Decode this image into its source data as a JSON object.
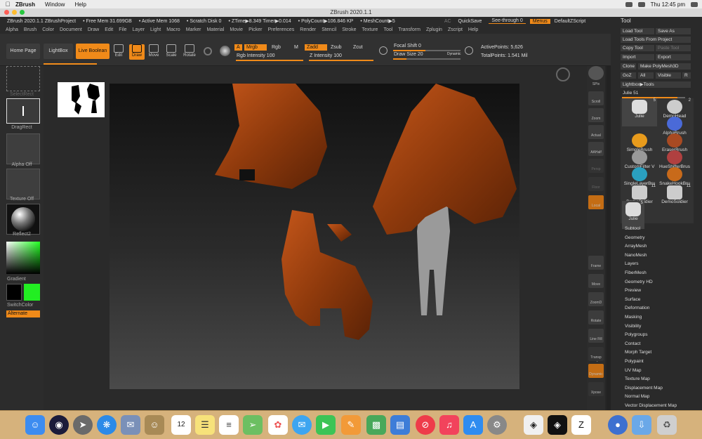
{
  "mac_menu": {
    "app": "ZBrush",
    "items": [
      "Window",
      "Help"
    ],
    "clock": "Thu 12:45 pm"
  },
  "window_title": "ZBrush 2020.1.1",
  "info_bar": {
    "project": "ZBrush 2020.1.1 ZBrushProject",
    "free_mem": "• Free Mem 31.699GB",
    "active_mem": "• Active Mem 1068",
    "scratch": "• Scratch Disk 0",
    "ztime": "• ZTime▶8.349 Timer▶0.014",
    "polycount": "• PolyCount▶106.846 KP",
    "meshcount": "• MeshCount▶5",
    "ac": "AC",
    "quicksave": "QuickSave",
    "see_through": "See-through  0",
    "menus": "Menus",
    "default_zscript": "DefaultZScript"
  },
  "zmenu_items": [
    "Alpha",
    "Brush",
    "Color",
    "Document",
    "Draw",
    "Edit",
    "File",
    "Layer",
    "Light",
    "Macro",
    "Marker",
    "Material",
    "Movie",
    "Picker",
    "Preferences",
    "Render",
    "Stencil",
    "Stroke",
    "Texture",
    "Tool",
    "Transform",
    "Zplugin",
    "Zscript",
    "Help"
  ],
  "tool_panel_title": "Tool",
  "topbar": {
    "home_page": "Home Page",
    "lightbox": "LightBox",
    "live_boolean": "Live Boolean",
    "tools": [
      "Edit",
      "Draw",
      "Move",
      "Scale",
      "Rotate"
    ],
    "a": "A",
    "mrgb": "Mrgb",
    "rgb": "Rgb",
    "m": "M",
    "rgb_intensity": "Rgb Intensity 100",
    "zadd": "Zadd",
    "zsub": "Zsub",
    "zcut": "Zcut",
    "z_intensity": "Z Intensity 100",
    "focal_shift": "Focal Shift 0",
    "draw_size": "Draw Size 20",
    "dynamic": "Dynamic",
    "active_points": "ActivePoints: 5,626",
    "total_points": "TotalPoints: 1.541 Mil"
  },
  "left_shelf": {
    "select_rect": "SelectRect",
    "drag_rect": "DragRect",
    "alpha_off": "Alpha Off",
    "texture_off": "Texture Off",
    "material": "Reflect2",
    "gradient": "Gradient",
    "switch_color": "SwitchColor",
    "alternate": "Alternate"
  },
  "right_shelf": [
    "SPix",
    "Scroll",
    "Zoom",
    "Actual",
    "AAHalf",
    "Persp",
    "Floor",
    "Local",
    "Frame",
    "Move",
    "ZoomD",
    "Rotate",
    "Line Fill PolyF",
    "Transp",
    "Dynamic Solo",
    "Xpose"
  ],
  "tool_panel": {
    "load_tool": "Load Tool",
    "save_as": "Save As",
    "load_from_project": "Load Tools From Project",
    "copy_tool": "Copy Tool",
    "paste_tool": "Paste Tool",
    "import": "Import",
    "export": "Export",
    "clone": "Clone",
    "make_polymesh": "Make PolyMesh3D",
    "goz": "GoZ",
    "all": "All",
    "visible": "Visible",
    "r": "R",
    "lightbox_tools": "Lightbox▶Tools",
    "current": "Julie  51",
    "grid": [
      {
        "label": "Julie",
        "num": "5"
      },
      {
        "label": "DemoHead",
        "num": "2"
      },
      {
        "label": "AlphaBrush",
        "num": ""
      },
      {
        "label": "SimpleBrush",
        "num": ""
      },
      {
        "label": "EraserBrush",
        "num": ""
      },
      {
        "label": "CustomFilter V",
        "num": ""
      },
      {
        "label": "HueShifterBrus",
        "num": ""
      },
      {
        "label": "SingleLayerBru",
        "num": ""
      },
      {
        "label": "SnakeHookBru",
        "num": ""
      },
      {
        "label": "DemoSoldier",
        "num": "11"
      },
      {
        "label": "DemoSoldier",
        "num": "11"
      },
      {
        "label": "Julie",
        "num": "5"
      }
    ],
    "submenus": [
      "Subtool",
      "Geometry",
      "ArrayMesh",
      "NanoMesh",
      "Layers",
      "FiberMesh",
      "Geometry HD",
      "Preview",
      "Surface",
      "Deformation",
      "Masking",
      "Visibility",
      "Polygroups",
      "Contact",
      "Morph Target",
      "Polypaint",
      "UV Map",
      "Texture Map",
      "Displacement Map",
      "Normal Map",
      "Vector Displacement Map"
    ]
  },
  "colors": {
    "accent": "#f08a19",
    "primary_color": "#000000",
    "secondary_color": "#22ee22",
    "sculpt": "#a8430f"
  },
  "dock_icons": [
    "finder-icon",
    "siri-icon",
    "launchpad-icon",
    "safari-icon",
    "mail-icon",
    "contacts-icon",
    "calendar-icon",
    "notes-icon",
    "reminders-icon",
    "maps-icon",
    "photos-icon",
    "messages-icon",
    "facetime-icon",
    "pages-icon",
    "numbers-icon",
    "keynote-icon",
    "news-icon",
    "music-icon",
    "appstore-icon",
    "preferences-icon",
    "unity-icon",
    "unity-icon",
    "zbrush-icon",
    "globe-icon",
    "downloads-icon",
    "trash-icon"
  ],
  "calendar_day": "12"
}
